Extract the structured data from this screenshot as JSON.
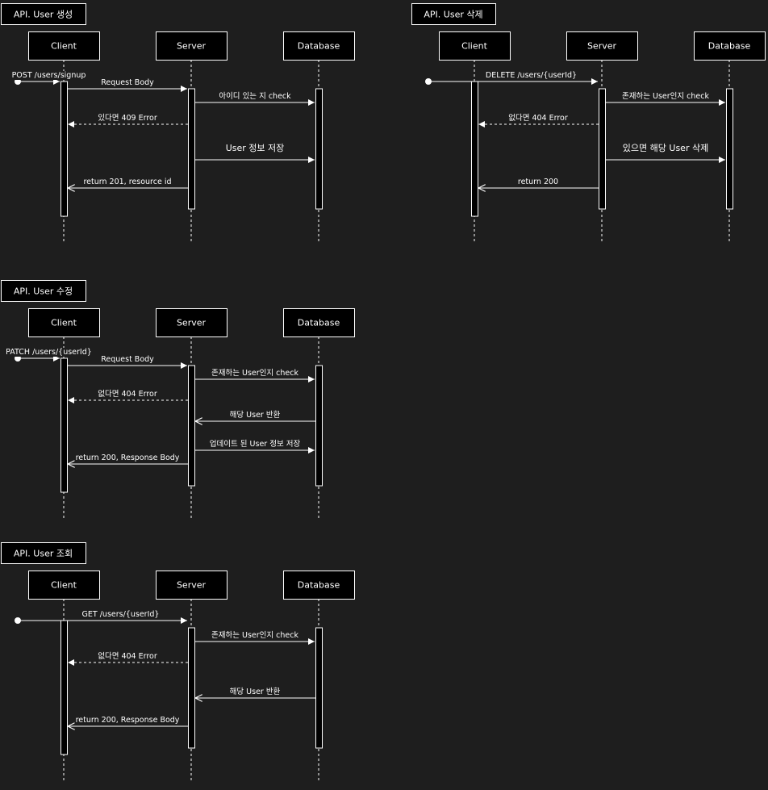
{
  "diagrams": [
    {
      "title": "API. User 생성",
      "participants": [
        "Client",
        "Server",
        "Database"
      ],
      "messages": [
        {
          "text": "POST /users/signup",
          "from": "start",
          "to": "Client",
          "style": "call"
        },
        {
          "text": "Request Body",
          "from": "Client",
          "to": "Server",
          "style": "call"
        },
        {
          "text": "아이디 있는 지 check",
          "from": "Server",
          "to": "Database",
          "style": "call"
        },
        {
          "text": "있다면 409 Error",
          "from": "Server",
          "to": "Client",
          "style": "error"
        },
        {
          "text": "User 정보 저장",
          "from": "Server",
          "to": "Database",
          "style": "call"
        },
        {
          "text": "return 201, resource id",
          "from": "Server",
          "to": "Client",
          "style": "reply"
        }
      ]
    },
    {
      "title": "API. User 삭제",
      "participants": [
        "Client",
        "Server",
        "Database"
      ],
      "messages": [
        {
          "text": "DELETE /users/{userId}",
          "from": "start",
          "to": "Server",
          "style": "call"
        },
        {
          "text": "존재하는 User인지 check",
          "from": "Server",
          "to": "Database",
          "style": "call"
        },
        {
          "text": "없다면 404 Error",
          "from": "Server",
          "to": "Client",
          "style": "error"
        },
        {
          "text": "있으면 해당 User 삭제",
          "from": "Server",
          "to": "Database",
          "style": "call"
        },
        {
          "text": "return 200",
          "from": "Server",
          "to": "Client",
          "style": "reply"
        }
      ]
    },
    {
      "title": "API. User 수정",
      "participants": [
        "Client",
        "Server",
        "Database"
      ],
      "messages": [
        {
          "text": "PATCH /users/{userId}",
          "from": "start",
          "to": "Client",
          "style": "call"
        },
        {
          "text": "Request Body",
          "from": "Client",
          "to": "Server",
          "style": "call"
        },
        {
          "text": "존재하는 User인지 check",
          "from": "Server",
          "to": "Database",
          "style": "call"
        },
        {
          "text": "없다면 404 Error",
          "from": "Server",
          "to": "Client",
          "style": "error"
        },
        {
          "text": "해당 User 반환",
          "from": "Database",
          "to": "Server",
          "style": "reply"
        },
        {
          "text": "업데이트 된 User 정보 저장",
          "from": "Server",
          "to": "Database",
          "style": "call"
        },
        {
          "text": "return 200, Response Body",
          "from": "Server",
          "to": "Client",
          "style": "reply"
        }
      ]
    },
    {
      "title": "API. User 조회",
      "participants": [
        "Client",
        "Server",
        "Database"
      ],
      "messages": [
        {
          "text": "GET /users/{userId}",
          "from": "start",
          "to": "Server",
          "style": "call"
        },
        {
          "text": "존재하는 User인지 check",
          "from": "Server",
          "to": "Database",
          "style": "call"
        },
        {
          "text": "없다면 404 Error",
          "from": "Server",
          "to": "Client",
          "style": "error"
        },
        {
          "text": "해당 User 반환",
          "from": "Database",
          "to": "Server",
          "style": "reply"
        },
        {
          "text": "return 200, Response Body",
          "from": "Server",
          "to": "Client",
          "style": "reply"
        }
      ]
    }
  ],
  "colors": {
    "background": "#1e1e1e",
    "box": "#000000",
    "line": "#ffffff",
    "text": "#ffffff"
  }
}
